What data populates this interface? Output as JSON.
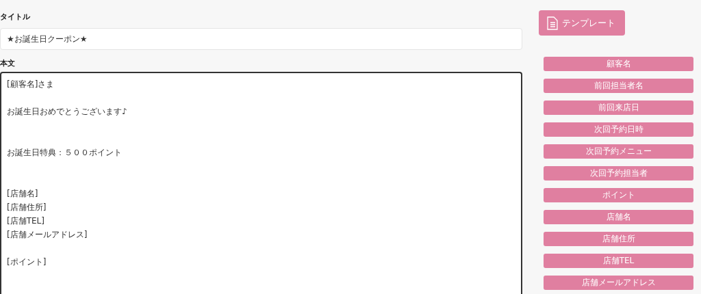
{
  "title_field": {
    "label": "タイトル",
    "value": "★お誕生日クーポン★"
  },
  "body_field": {
    "label": "本文",
    "lines": [
      {
        "kind": "text",
        "text": "[顧客名]さま"
      },
      {
        "kind": "blank"
      },
      {
        "kind": "text",
        "text": "お誕生日おめでとうございます♪"
      },
      {
        "kind": "blank"
      },
      {
        "kind": "blank"
      },
      {
        "kind": "text",
        "text": "お誕生日特典：５００ポイント　"
      },
      {
        "kind": "blank"
      },
      {
        "kind": "blank"
      },
      {
        "kind": "text",
        "text": "[店舗名]"
      },
      {
        "kind": "text",
        "text": "[店舗住所]"
      },
      {
        "kind": "text",
        "text": "[店舗TEL]"
      },
      {
        "kind": "text",
        "text": "[店舗メールアドレス]"
      },
      {
        "kind": "blank"
      },
      {
        "kind": "text",
        "text": "[ポイント]"
      }
    ]
  },
  "template_button": {
    "label": "テンプレート"
  },
  "variable_buttons": [
    "顧客名",
    "前回担当者名",
    "前回来店日",
    "次回予約日時",
    "次回予約メニュー",
    "次回予約担当者",
    "ポイント",
    "店舗名",
    "店舗住所",
    "店舗TEL",
    "店舗メールアドレス"
  ]
}
